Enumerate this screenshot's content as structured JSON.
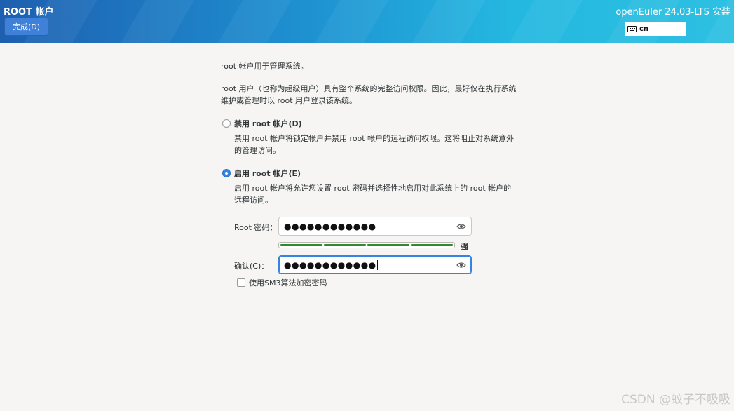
{
  "header": {
    "title": "ROOT 帐户",
    "done_label": "完成(D)",
    "product": "openEuler 24.03-LTS 安装",
    "keyboard_layout": "cn"
  },
  "intro": "root 帐户用于管理系统。",
  "description": "root 用户（也称为超级用户）具有整个系统的完整访问权限。因此，最好仅在执行系统维护或管理时以 root 用户登录该系统。",
  "options": {
    "disable": {
      "label": "禁用 root 帐户(D)",
      "checked": false,
      "text": "禁用 root 帐户将锁定帐户并禁用 root 帐户的远程访问权限。这将阻止对系统意外的管理访问。"
    },
    "enable": {
      "label": "启用 root 帐户(E)",
      "checked": true,
      "text": "启用 root 帐户将允许您设置 root 密码并选择性地启用对此系统上的 root 帐户的远程访问。"
    }
  },
  "password": {
    "label": "Root 密码：",
    "value": "●●●●●●●●●●●●"
  },
  "strength": {
    "label": "强",
    "level": 1.0,
    "color": "#2f8a2f"
  },
  "confirm": {
    "label": "确认(C)：",
    "value": "●●●●●●●●●●●●"
  },
  "sm3": {
    "label": "使用SM3算法加密密码",
    "checked": false
  },
  "watermark": "CSDN @蚊子不吸吸",
  "colors": {
    "accent": "#3584e4",
    "header_start": "#1e5fb0",
    "header_end": "#2ec0e2"
  }
}
